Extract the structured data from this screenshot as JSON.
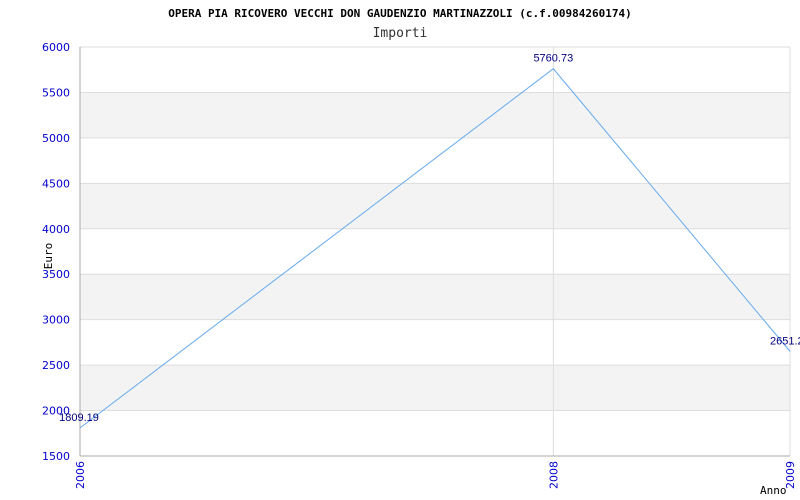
{
  "chart_data": {
    "type": "line",
    "title": "OPERA PIA RICOVERO VECCHI DON GAUDENZIO MARTINAZZOLI (c.f.00984260174)",
    "subtitle": "Importi",
    "xlabel": "Anno",
    "ylabel": "Euro",
    "x": [
      2006,
      2008,
      2009
    ],
    "x_tick_labels": [
      "2006",
      "2008",
      "2009"
    ],
    "xlim": [
      2006,
      2009
    ],
    "ylim": [
      1500,
      6000
    ],
    "y_ticks": [
      1500,
      2000,
      2500,
      3000,
      3500,
      4000,
      4500,
      5000,
      5500,
      6000
    ],
    "series": [
      {
        "values": [
          1809.19,
          5760.73,
          2651.2
        ],
        "labels": [
          "1809.19",
          "5760.73",
          "2651.2"
        ],
        "color": "#66aaee"
      }
    ],
    "grid": true,
    "band_colors": [
      "#ffffff",
      "#f3f3f3"
    ],
    "grid_color": "#dddddd",
    "axis_color": "#aaaaaa"
  }
}
